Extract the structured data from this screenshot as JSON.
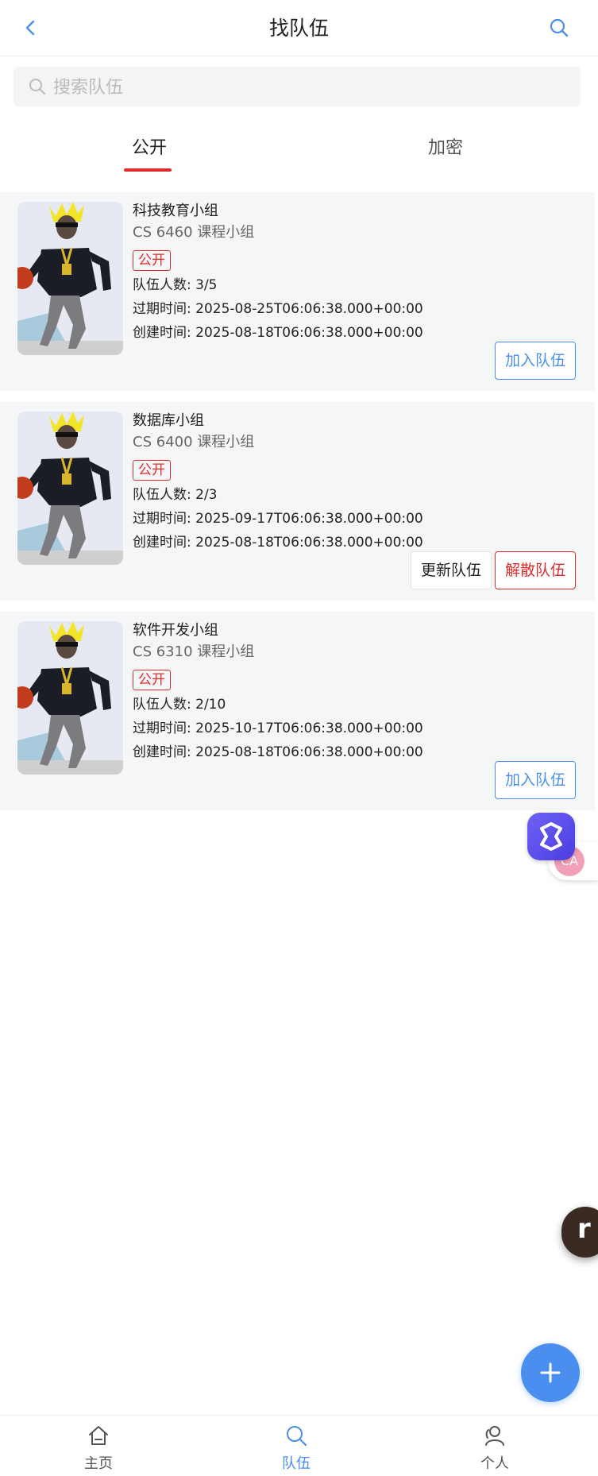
{
  "header": {
    "title": "找队伍"
  },
  "search": {
    "placeholder": "搜索队伍",
    "value": ""
  },
  "tabs": [
    {
      "label": "公开",
      "active": true
    },
    {
      "label": "加密",
      "active": false
    }
  ],
  "teams": [
    {
      "name": "科技教育小组",
      "course": "CS 6460 课程小组",
      "visibility": "公开",
      "members": "队伍人数: 3/5",
      "expire": "过期时间: 2025-08-25T06:06:38.000+00:00",
      "created": "创建时间: 2025-08-18T06:06:38.000+00:00",
      "actions": [
        "加入队伍"
      ]
    },
    {
      "name": "数据库小组",
      "course": "CS 6400 课程小组",
      "visibility": "公开",
      "members": "队伍人数: 2/3",
      "expire": "过期时间: 2025-09-17T06:06:38.000+00:00",
      "created": "创建时间: 2025-08-18T06:06:38.000+00:00",
      "actions": [
        "更新队伍",
        "解散队伍"
      ]
    },
    {
      "name": "软件开发小组",
      "course": "CS 6310 课程小组",
      "visibility": "公开",
      "members": "队伍人数: 2/10",
      "expire": "过期时间: 2025-10-17T06:06:38.000+00:00",
      "created": "创建时间: 2025-08-18T06:06:38.000+00:00",
      "actions": [
        "加入队伍"
      ]
    }
  ],
  "floating": {
    "pill_text": "CA",
    "r_text": "r"
  },
  "bottom_nav": [
    {
      "label": "主页",
      "icon": "home-icon",
      "active": false
    },
    {
      "label": "队伍",
      "icon": "search-icon",
      "active": true
    },
    {
      "label": "个人",
      "icon": "user-icon",
      "active": false
    }
  ],
  "colors": {
    "accent": "#4a8ef0",
    "danger": "#e02b2b",
    "card_bg": "#f5f6f8"
  }
}
